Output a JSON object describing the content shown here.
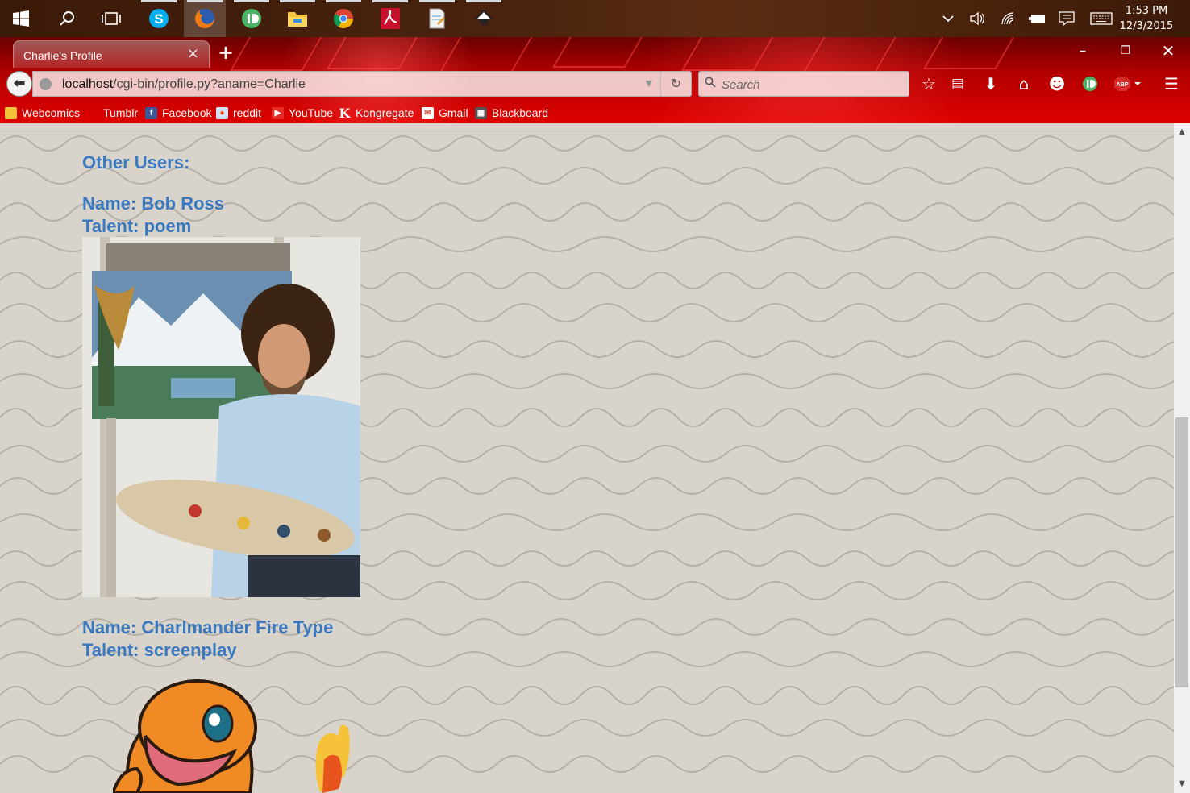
{
  "taskbar": {
    "apps": [
      {
        "name": "start",
        "icon": "windows-logo-icon"
      },
      {
        "name": "search",
        "icon": "search-icon"
      },
      {
        "name": "task-view",
        "icon": "task-view-icon"
      },
      {
        "name": "skype",
        "icon": "skype-icon"
      },
      {
        "name": "firefox",
        "icon": "firefox-icon",
        "active": true
      },
      {
        "name": "pushbullet",
        "icon": "pushbullet-icon"
      },
      {
        "name": "file-explorer",
        "icon": "folder-icon"
      },
      {
        "name": "chrome",
        "icon": "chrome-icon"
      },
      {
        "name": "acrobat",
        "icon": "acrobat-icon"
      },
      {
        "name": "notepad",
        "icon": "document-icon"
      },
      {
        "name": "inkscape",
        "icon": "inkscape-icon"
      }
    ],
    "clock_time": "1:53 PM",
    "clock_date": "12/3/2015"
  },
  "browser": {
    "tab_title": "Charlie's Profile",
    "url_host": "localhost",
    "url_path": "/cgi-bin/profile.py?aname=Charlie",
    "search_placeholder": "Search",
    "bookmarks": [
      {
        "label": "Webcomics",
        "icon": "folder-icon",
        "color": "#f3c33a"
      },
      {
        "label": "Tumblr",
        "icon": "blank-icon",
        "color": ""
      },
      {
        "label": "Facebook",
        "icon": "facebook-icon",
        "color": "#3b5998"
      },
      {
        "label": "reddit",
        "icon": "reddit-icon",
        "color": "#cee3f8"
      },
      {
        "label": "YouTube",
        "icon": "youtube-icon",
        "color": "#e52d27"
      },
      {
        "label": "Kongregate",
        "icon": "kongregate-icon",
        "color": "#990000"
      },
      {
        "label": "Gmail",
        "icon": "gmail-icon",
        "color": "#d44638"
      },
      {
        "label": "Blackboard",
        "icon": "blackboard-icon",
        "color": "#555555"
      }
    ]
  },
  "page": {
    "heading": "Other Users:",
    "users": [
      {
        "name_line": "Name: Bob Ross",
        "talent_line": "Talent: poem"
      },
      {
        "name_line": "Name: Charlmander Fire Type",
        "talent_line": "Talent: screenplay"
      }
    ],
    "text_color": "#3a78c0",
    "background_color": "#d8d4cb"
  },
  "colors": {
    "theme_red": "#d40000",
    "taskbar_brown": "#4b2410"
  }
}
